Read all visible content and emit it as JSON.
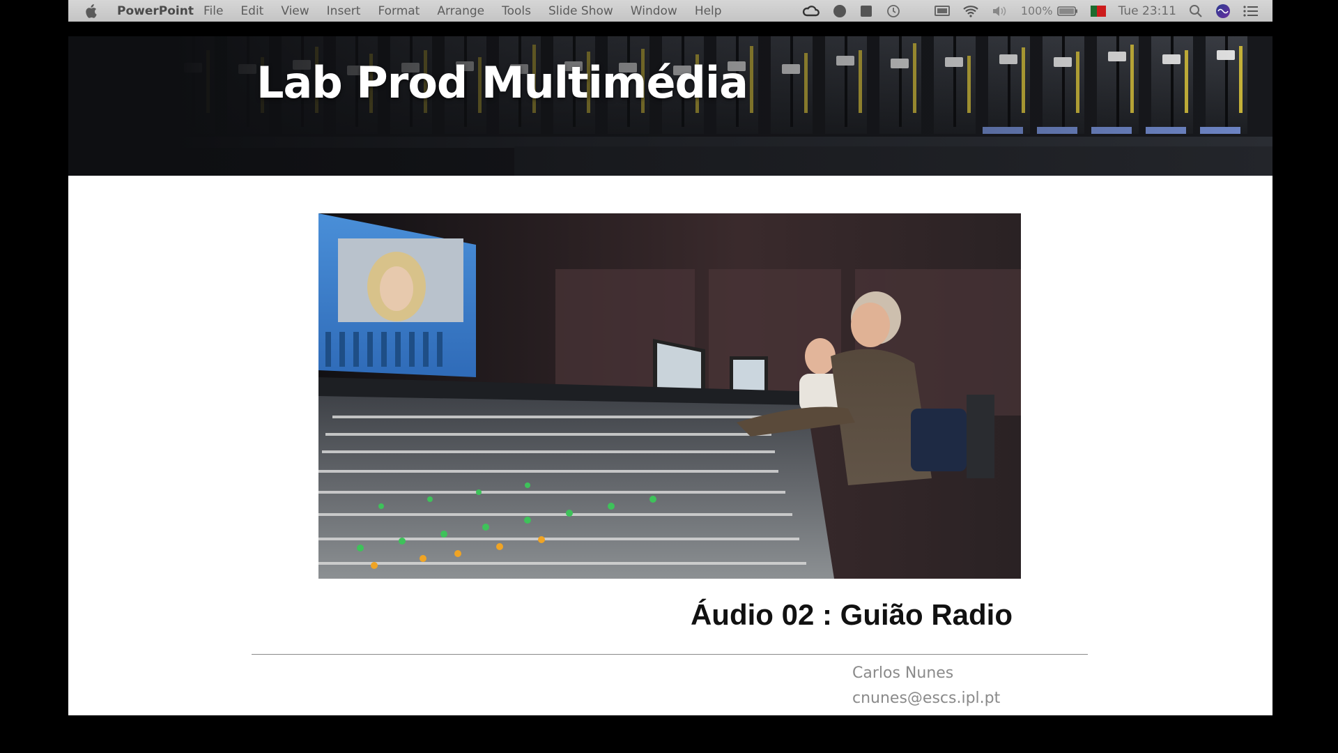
{
  "menubar": {
    "app_name": "PowerPoint",
    "menus": [
      "File",
      "Edit",
      "View",
      "Insert",
      "Format",
      "Arrange",
      "Tools",
      "Slide Show",
      "Window",
      "Help"
    ],
    "battery": "100%",
    "clock": "Tue 23:11",
    "icons": [
      "apple-icon",
      "creative-cloud-icon",
      "record-icon",
      "stop-icon",
      "time-machine-icon",
      "display-icon",
      "wifi-icon",
      "volume-icon",
      "battery-icon",
      "flag-icon",
      "search-icon",
      "siri-icon",
      "notification-list-icon"
    ]
  },
  "slide": {
    "title": "Lab Prod Multimédia",
    "subtitle": "Áudio 02 : Guião Radio",
    "author_name": "Carlos Nunes",
    "author_email": "cnunes@escs.ipl.pt"
  },
  "colors": {
    "menubar": "#c8c8c8",
    "slide_bg": "#ffffff",
    "header_band": "#0e0f12"
  }
}
